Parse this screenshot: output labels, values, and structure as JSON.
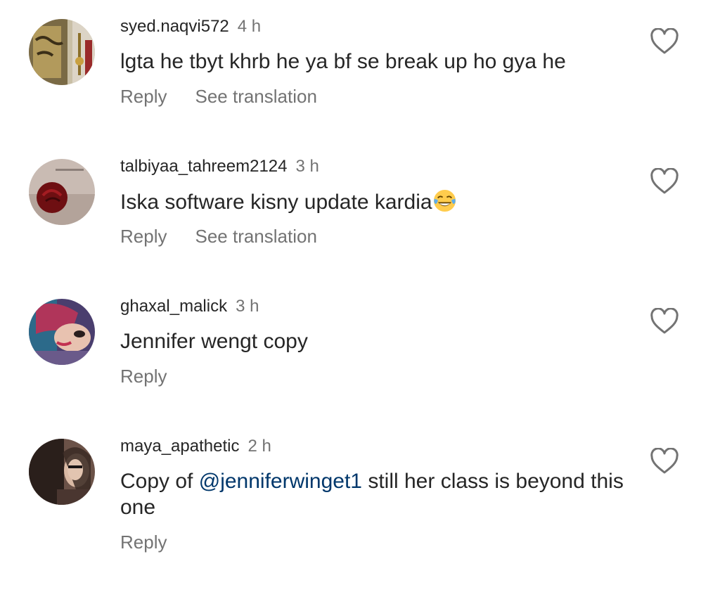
{
  "comments": [
    {
      "username": "syed.naqvi572",
      "time": "4 h",
      "text": "lgta he tbyt khrb he ya bf se break up ho gya he",
      "reply_label": "Reply",
      "translate_label": "See translation"
    },
    {
      "username": "talbiyaa_tahreem2124",
      "time": "3 h",
      "text": "Iska software kisny update kardia",
      "reply_label": "Reply",
      "translate_label": "See translation"
    },
    {
      "username": "ghaxal_malick",
      "time": "3 h",
      "text": "Jennifer wengt copy",
      "reply_label": "Reply"
    },
    {
      "username": "maya_apathetic",
      "time": "2 h",
      "text_before": "Copy of ",
      "mention": "@jenniferwinget1",
      "text_after": " still her class is beyond this one",
      "reply_label": "Reply"
    }
  ],
  "icons": {
    "like": "heart-outline-icon",
    "emoji": "face-with-tears-of-joy-emoji"
  },
  "colors": {
    "text": "#262626",
    "secondary": "#737373",
    "mention": "#00376b"
  }
}
